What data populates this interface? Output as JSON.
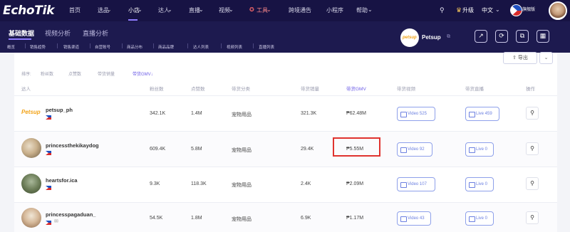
{
  "app": {
    "logo": "EchoTik"
  },
  "topnav": {
    "items": [
      "首页",
      "选品",
      "小店",
      "达人",
      "直播",
      "视频",
      "工具",
      "跨境通告",
      "小程序",
      "帮助"
    ],
    "upgrade": "升级",
    "language": "中文",
    "vip_label": "旗舰版"
  },
  "tabs": [
    "基础数据",
    "视频分析",
    "直播分析"
  ],
  "subtabs": [
    "概览",
    "销售趋势",
    "销售渠道",
    "自营账号",
    "商品分布",
    "商品品牌",
    "达人列表",
    "视频列表",
    "直播列表"
  ],
  "shop": {
    "name": "Petsup",
    "logo_text": "petsup"
  },
  "toolbar": {
    "export": "导出",
    "dropdown": "⌄"
  },
  "sort": {
    "label": "排序:",
    "options": [
      "粉丝数",
      "点赞数",
      "带货销量",
      "带货GMV↓"
    ],
    "active_index": 3
  },
  "table": {
    "headers": [
      "达人",
      "粉丝数",
      "点赞数",
      "带货分类",
      "带货销量",
      "带货GMV",
      "带货视频",
      "带货直播",
      "操作"
    ],
    "rows": [
      {
        "name": "petsup_ph",
        "logo": "Petsup",
        "followers": "342.1K",
        "likes": "1.4M",
        "category": "宠物用品",
        "sales": "321.3K",
        "gmv": "₱62.48M",
        "video": "Video 525",
        "live": "Live 459"
      },
      {
        "name": "princessthekikaydog",
        "followers": "609.4K",
        "likes": "5.8M",
        "category": "宠物用品",
        "sales": "29.4K",
        "gmv": "₱5.55M",
        "video": "Video 92",
        "live": "Live 0"
      },
      {
        "name": "heartsfor.ica",
        "followers": "9.3K",
        "likes": "118.3K",
        "category": "宠物用品",
        "sales": "2.4K",
        "gmv": "₱2.09M",
        "video": "Video 107",
        "live": "Live 0"
      },
      {
        "name": "princesspagaduan_",
        "followers": "54.5K",
        "likes": "1.8M",
        "category": "宠物用品",
        "sales": "6.9K",
        "gmv": "₱1.17M",
        "video": "Video 43",
        "live": "Live 0"
      }
    ]
  },
  "colors": {
    "nav_bg": "#171344",
    "accent": "#6c5ce7",
    "highlight": "#e0332f"
  }
}
